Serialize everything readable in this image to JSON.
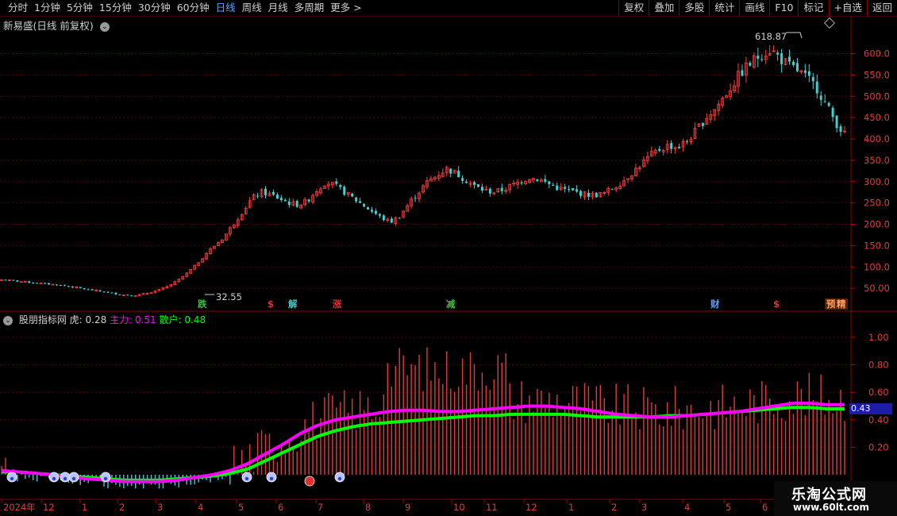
{
  "toolbar": {
    "periods": [
      "分时",
      "1分钟",
      "5分钟",
      "15分钟",
      "30分钟",
      "60分钟",
      "日线",
      "周线",
      "月线",
      "多周期",
      "更多 >"
    ],
    "active_period": "日线",
    "right_buttons": [
      "复权",
      "叠加",
      "多股",
      "统计",
      "画线",
      "F10",
      "标记",
      "+自选",
      "返回"
    ]
  },
  "main_chart": {
    "title": "新易盛(日线 前复权)",
    "high_label": "618.87",
    "low_label": "32.55",
    "price_ticks": [
      "600.0",
      "550.0",
      "500.0",
      "450.0",
      "400.0",
      "350.0",
      "300.0",
      "250.0",
      "200.0",
      "150.0",
      "100.0",
      "50.00"
    ],
    "event_badges": [
      {
        "text": "跌",
        "color": "#3fbf3f"
      },
      {
        "text": "$",
        "color": "#e03030"
      },
      {
        "text": "解",
        "color": "#40c8c8"
      },
      {
        "text": "涨",
        "color": "#e03030"
      },
      {
        "text": "减",
        "color": "#3fbf3f"
      },
      {
        "text": "财",
        "color": "#5aa0ff"
      },
      {
        "text": "$",
        "color": "#e03030"
      },
      {
        "text": "预",
        "color": "#e03030"
      },
      {
        "text": "精",
        "color": "#e07030"
      }
    ]
  },
  "indicator": {
    "name": "股朋指标网",
    "tiger_label": "虎:",
    "tiger_value": "0.28",
    "main_label": "主力:",
    "main_value": "0.51",
    "retail_label": "散户:",
    "retail_value": "0.48",
    "ticks": [
      "1.00",
      "0.80",
      "0.60",
      "0.40",
      "0.20"
    ],
    "current_value": "0.43",
    "colors": {
      "main": "#ff00ff",
      "retail": "#00ff00",
      "bar": "#e03c3c",
      "neg_bar": "#40c8e0"
    }
  },
  "month_axis": [
    "2024年",
    "12",
    "1",
    "2",
    "3",
    "4",
    "5",
    "6",
    "7",
    "8",
    "9",
    "10",
    "11",
    "12",
    "1",
    "2",
    "3",
    "4",
    "5",
    "6"
  ],
  "watermark": {
    "line1": "乐淘公式网",
    "line2": "www.60lt.com"
  },
  "chart_data": [
    {
      "type": "line",
      "title": "新易盛(日线 前复权)",
      "ylim": [
        0,
        640
      ],
      "series": [
        {
          "values": [
            70,
            68,
            66,
            64,
            62,
            60,
            58,
            55,
            52,
            48,
            45,
            42,
            38,
            35,
            33,
            35,
            40,
            46,
            55,
            68,
            85,
            105,
            130,
            150,
            170,
            200,
            230,
            260,
            275,
            270,
            260,
            250,
            245,
            255,
            280,
            300,
            290,
            275,
            260,
            245,
            230,
            215,
            205,
            220,
            250,
            275,
            300,
            315,
            330,
            320,
            305,
            290,
            280,
            275,
            280,
            290,
            300,
            310,
            305,
            295,
            285,
            280,
            275,
            270,
            268,
            272,
            285,
            300,
            320,
            340,
            360,
            375,
            385,
            380,
            395,
            420,
            450,
            470,
            500,
            530,
            560,
            580,
            600,
            610,
            590,
            570,
            560,
            540,
            520,
            480,
            440,
            410
          ]
        }
      ]
    },
    {
      "type": "bar",
      "title": "股朋指标网",
      "ylim": [
        -0.1,
        1.1
      ],
      "series": [
        {
          "name": "主力",
          "values": [
            0.03,
            0.02,
            0.01,
            0.0,
            -0.02,
            -0.03,
            -0.04,
            -0.05,
            -0.05,
            -0.05,
            -0.04,
            -0.02,
            0.0,
            0.03,
            0.08,
            0.15,
            0.22,
            0.3,
            0.36,
            0.4,
            0.42,
            0.44,
            0.46,
            0.47,
            0.47,
            0.46,
            0.46,
            0.47,
            0.48,
            0.49,
            0.5,
            0.5,
            0.49,
            0.48,
            0.46,
            0.44,
            0.43,
            0.42,
            0.42,
            0.43,
            0.44,
            0.45,
            0.46,
            0.48,
            0.5,
            0.52,
            0.52,
            0.51,
            0.51
          ]
        },
        {
          "name": "散户",
          "values": [
            0.02,
            0.02,
            0.01,
            0.0,
            -0.01,
            -0.02,
            -0.03,
            -0.04,
            -0.04,
            -0.04,
            -0.03,
            -0.02,
            -0.01,
            0.01,
            0.04,
            0.1,
            0.16,
            0.22,
            0.28,
            0.32,
            0.35,
            0.37,
            0.38,
            0.39,
            0.4,
            0.41,
            0.42,
            0.43,
            0.43,
            0.44,
            0.44,
            0.44,
            0.44,
            0.43,
            0.42,
            0.42,
            0.42,
            0.42,
            0.43,
            0.43,
            0.44,
            0.45,
            0.46,
            0.47,
            0.48,
            0.49,
            0.49,
            0.48,
            0.48
          ]
        }
      ]
    }
  ]
}
